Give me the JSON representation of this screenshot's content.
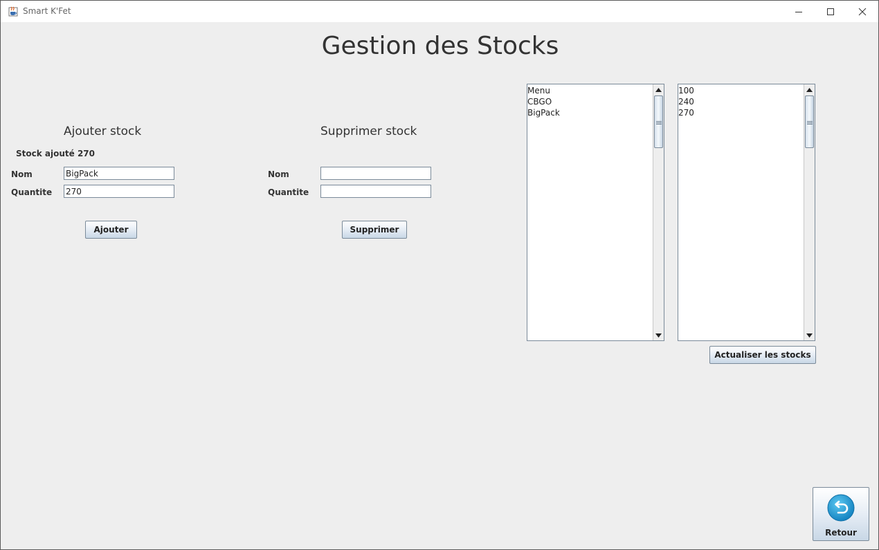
{
  "window": {
    "title": "Smart K'Fet",
    "app_icon": "java-cup-icon",
    "controls": {
      "minimize": "minimize-icon",
      "maximize": "maximize-icon",
      "close": "close-icon"
    }
  },
  "page": {
    "title": "Gestion des Stocks"
  },
  "add_section": {
    "title": "Ajouter stock",
    "status": "Stock ajouté 270",
    "name_label": "Nom",
    "name_value": "BigPack",
    "quantity_label": "Quantite",
    "quantity_value": "270",
    "button_label": "Ajouter"
  },
  "remove_section": {
    "title": "Supprimer stock",
    "name_label": "Nom",
    "name_value": "",
    "quantity_label": "Quantite",
    "quantity_value": "",
    "button_label": "Supprimer"
  },
  "lists": {
    "names": [
      "Menu",
      "CBGO",
      "BigPack"
    ],
    "quantities": [
      "100",
      "240",
      "270"
    ],
    "refresh_label": "Actualiser les stocks"
  },
  "back": {
    "label": "Retour",
    "icon": "undo-arrow-icon"
  },
  "colors": {
    "window_bg": "#eeeeee",
    "titlebar_bg": "#ffffff",
    "button_border": "#7a8a99",
    "retour_icon_blue": "#1f9fd6"
  }
}
